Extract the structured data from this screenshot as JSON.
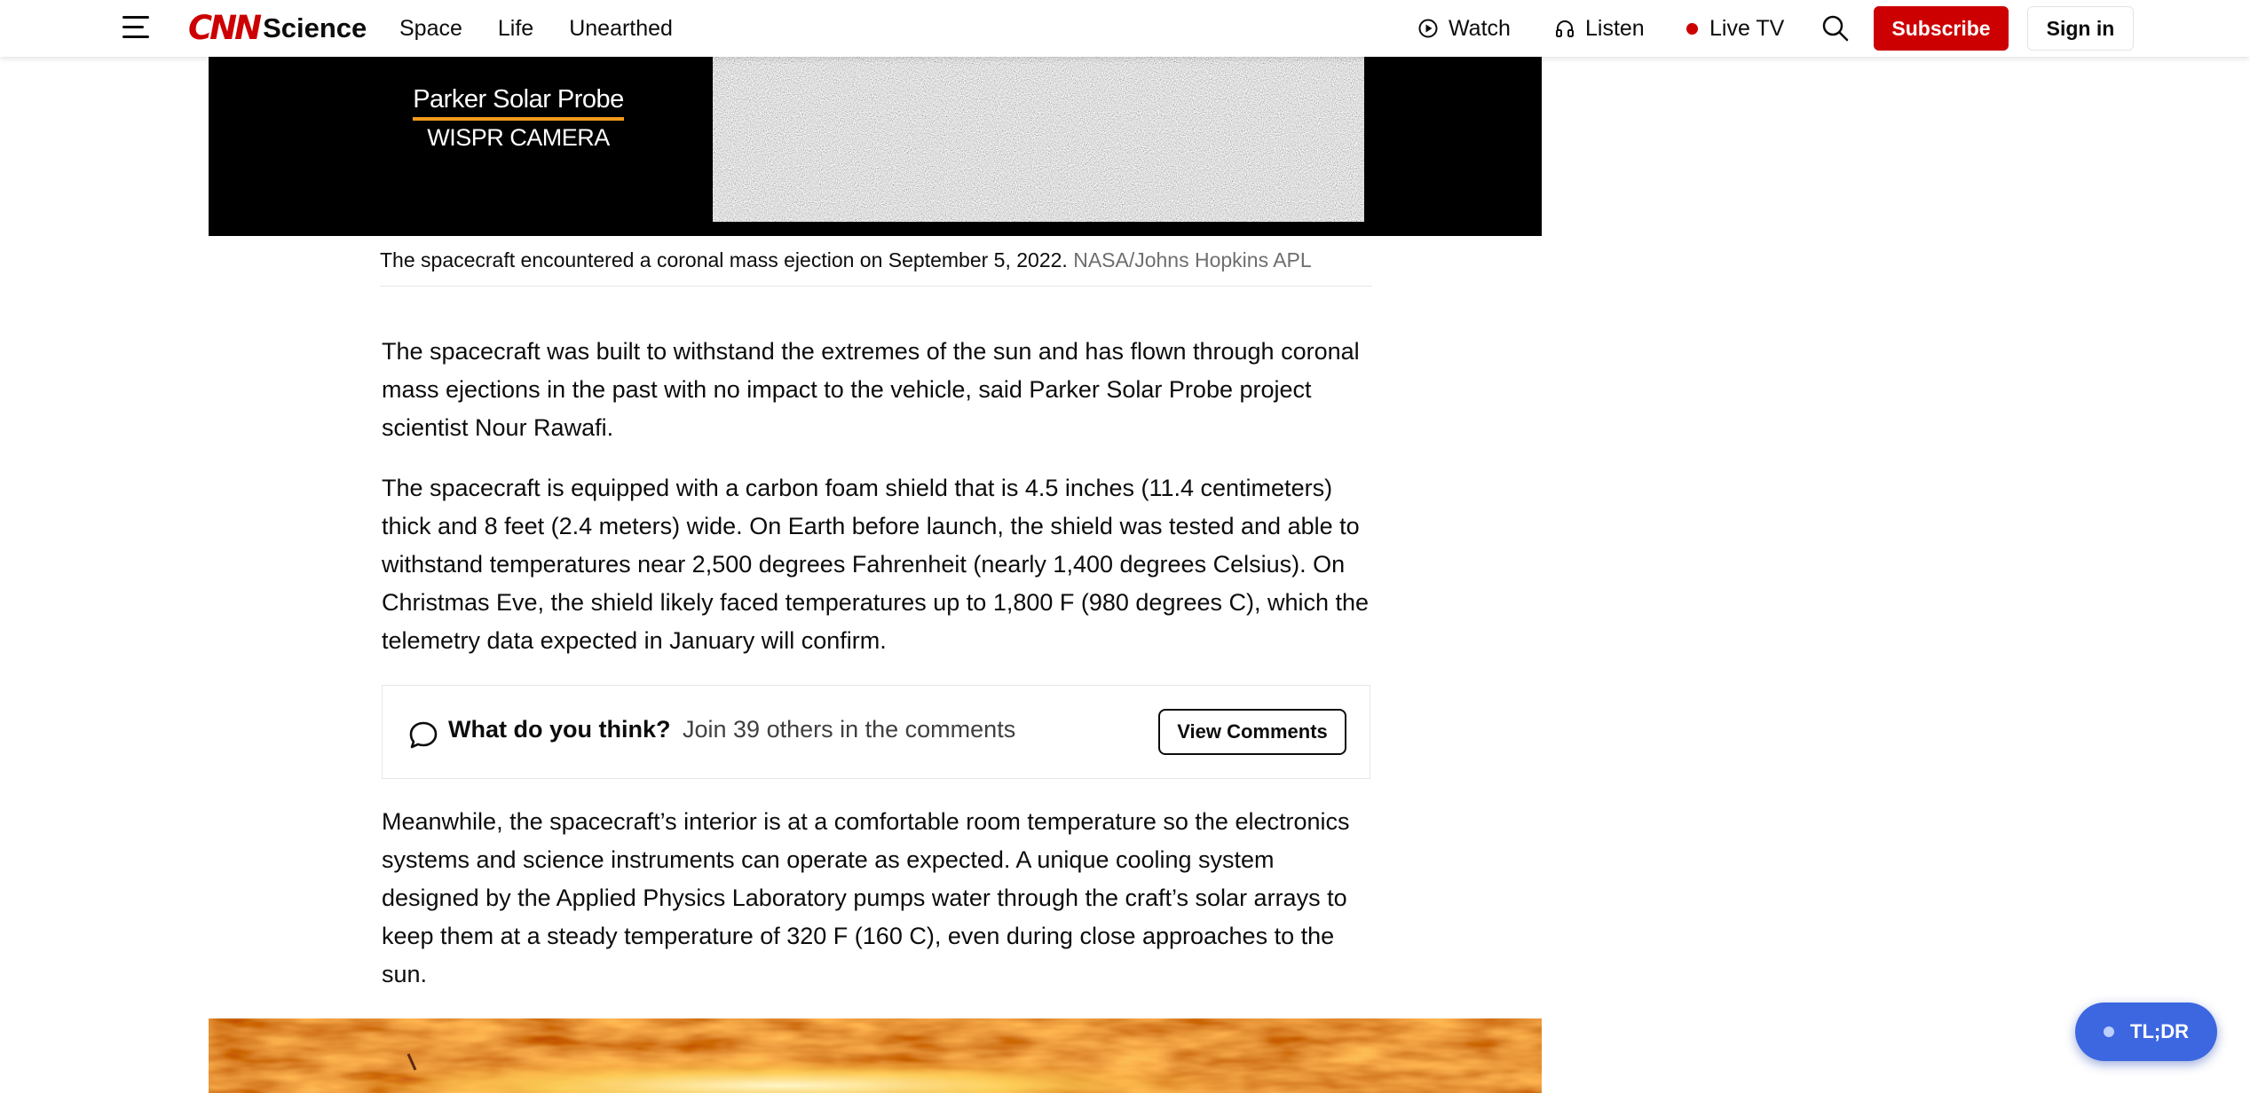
{
  "header": {
    "brand_mark": "CNN",
    "brand_section": "Science",
    "nav": [
      "Space",
      "Life",
      "Unearthed"
    ],
    "watch_label": "Watch",
    "listen_label": "Listen",
    "live_tv_label": "Live TV",
    "subscribe_label": "Subscribe",
    "signin_label": "Sign in",
    "brand_color": "#cc0000"
  },
  "top_image": {
    "overlay_line1": "Parker Solar Probe",
    "overlay_line2": "WISPR CAMERA",
    "caption": "The spacecraft encountered a coronal mass ejection on September 5, 2022.",
    "credit": "NASA/Johns Hopkins APL"
  },
  "article": {
    "paragraphs": [
      "The spacecraft was built to withstand the extremes of the sun and has flown through coronal mass ejections in the past with no impact to the vehicle, said Parker Solar Probe project scientist Nour Rawafi.",
      "The spacecraft is equipped with a carbon foam shield that is 4.5 inches (11.4 centimeters) thick and 8 feet (2.4 meters) wide. On Earth before launch, the shield was tested and able to withstand temperatures near 2,500 degrees Fahrenheit (nearly 1,400 degrees Celsius). On Christmas Eve, the shield likely faced temperatures up to 1,800 F (980 degrees C), which the telemetry data expected in January will confirm.",
      "Meanwhile, the spacecraft’s interior is at a comfortable room temperature so the electronics systems and science instruments can operate as expected. A unique cooling system designed by the Applied Physics Laboratory pumps water through the craft’s solar arrays to keep them at a steady temperature of 320 F (160 C), even during close approaches to the sun."
    ]
  },
  "comments": {
    "question": "What do you think?",
    "subtext": "Join 39 others in the comments",
    "button_label": "View Comments"
  },
  "tldr": {
    "label": "TL;DR",
    "color": "#3c67e0"
  }
}
